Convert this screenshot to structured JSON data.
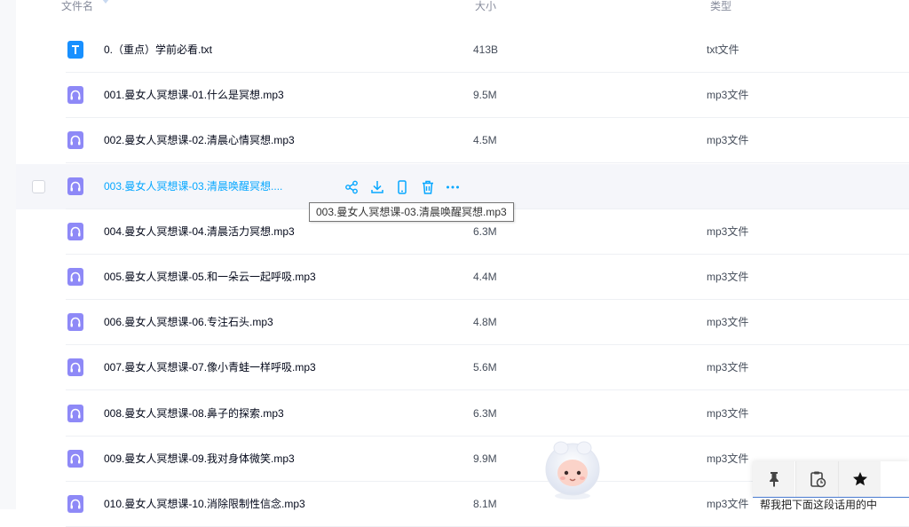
{
  "header": {
    "col_name": "文件名",
    "col_size": "大小",
    "col_type": "类型"
  },
  "files": [
    {
      "name": "0.（重点）学前必看.txt",
      "size": "413B",
      "type": "txt文件",
      "icon": "txt-file-icon"
    },
    {
      "name": "001.曼女人冥想课-01.什么是冥想.mp3",
      "size": "9.5M",
      "type": "mp3文件",
      "icon": "audio-file-icon"
    },
    {
      "name": "002.曼女人冥想课-02.清晨心情冥想.mp3",
      "size": "4.5M",
      "type": "mp3文件",
      "icon": "audio-file-icon"
    },
    {
      "name": "003.曼女人冥想课-03.清晨唤醒冥想....",
      "size": "",
      "type": "",
      "icon": "audio-file-icon"
    },
    {
      "name": "004.曼女人冥想课-04.清晨活力冥想.mp3",
      "size": "6.3M",
      "type": "mp3文件",
      "icon": "audio-file-icon"
    },
    {
      "name": "005.曼女人冥想课-05.和一朵云一起呼吸.mp3",
      "size": "4.4M",
      "type": "mp3文件",
      "icon": "audio-file-icon"
    },
    {
      "name": "006.曼女人冥想课-06.专注石头.mp3",
      "size": "4.8M",
      "type": "mp3文件",
      "icon": "audio-file-icon"
    },
    {
      "name": "007.曼女人冥想课-07.像小青蛙一样呼吸.mp3",
      "size": "5.6M",
      "type": "mp3文件",
      "icon": "audio-file-icon"
    },
    {
      "name": "008.曼女人冥想课-08.鼻子的探索.mp3",
      "size": "6.3M",
      "type": "mp3文件",
      "icon": "audio-file-icon"
    },
    {
      "name": "009.曼女人冥想课-09.我对身体微笑.mp3",
      "size": "9.9M",
      "type": "mp3文件",
      "icon": "audio-file-icon"
    },
    {
      "name": "010.曼女人冥想课-10.消除限制性信念.mp3",
      "size": "8.1M",
      "type": "mp3文件",
      "icon": "audio-file-icon"
    }
  ],
  "hover_row_index": 3,
  "row_actions": [
    "share-icon",
    "download-icon",
    "phone-icon",
    "delete-icon",
    "more-icon"
  ],
  "tooltip": "003.曼女人冥想课-03.清晨唤醒冥想.mp3",
  "toolbar_icons": [
    "pin-icon",
    "clipboard-history-icon",
    "star-icon"
  ],
  "toolbar_strip_text": "帮我把下面这段话用的中",
  "colors": {
    "accent": "#06a7ff",
    "audio_icon": "#7a74f6",
    "txt_icon": "#1890ff",
    "hover_bg": "#f5f6fa"
  }
}
